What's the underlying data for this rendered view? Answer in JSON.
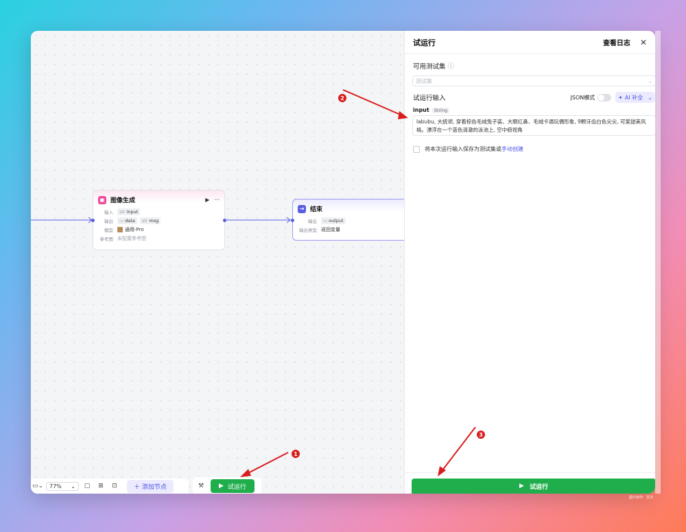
{
  "canvas": {
    "image_node": {
      "title": "图像生成",
      "run_icon": "▶",
      "more_icon": "···",
      "rows": [
        {
          "label": "输入",
          "chips": [
            {
              "type": "str",
              "name": "input"
            }
          ]
        },
        {
          "label": "输出",
          "chips": [
            {
              "type": "img",
              "name": "data"
            },
            {
              "type": "str",
              "name": "msg"
            }
          ]
        },
        {
          "label": "模型",
          "value": "通用-Pro"
        },
        {
          "label": "参考图",
          "value": "未配置参考图"
        }
      ]
    },
    "end_node": {
      "title": "结束",
      "rows": [
        {
          "label": "输出",
          "chip": {
            "type": "img",
            "name": "output"
          }
        },
        {
          "label": "输出类型",
          "value": "返回变量"
        }
      ]
    }
  },
  "toolbar": {
    "zoom": "77%",
    "add_node_label": "添加节点",
    "run_label": "试运行"
  },
  "panel": {
    "title": "试运行",
    "log_label": "查看日志",
    "testset_label": "可用测试集",
    "testset_placeholder": "测试集",
    "input_section_label": "试运行输入",
    "json_mode_label": "JSON模式",
    "ai_fill_label": "AI 补全",
    "field_name": "input",
    "field_type": "String",
    "field_value": "labubu, 大统领, 穿着棕色毛绒兔子装、大眼红鼻、毛绒卡通玩偶形象, 9颗牙齿白色尖尖, 可爱甜美风格。漂浮在一个蓝色清澈的泳池上, 空中俯视角",
    "save_text": "将本次运行输入保存为测试集或",
    "save_link": "手动创建",
    "run_button_label": "试运行"
  },
  "annotations": [
    "1",
    "2",
    "3"
  ],
  "watermark": "图片制作：贾洋"
}
